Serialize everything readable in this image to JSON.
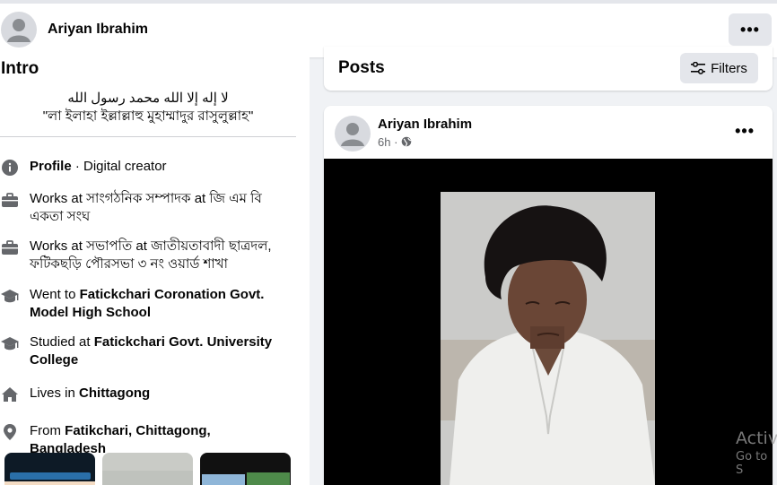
{
  "profile": {
    "name": "Ariyan Ibrahim",
    "more_label": "•••"
  },
  "intro": {
    "title": "Intro",
    "bio_line1": "لا إله إلا الله محمد رسول الله",
    "bio_line2": "\"লা ইলাহা ইল্লাল্লাহু মুহাম্মাদুর রাসুলুল্লাহ\"",
    "items": [
      {
        "icon": "info-icon",
        "bold": "Profile",
        "rest": " · Digital creator"
      },
      {
        "icon": "briefcase-icon",
        "text": "Works at সাংগঠনিক সম্পাদক at জি এম বি একতা সংঘ"
      },
      {
        "icon": "briefcase-icon",
        "text": "Works at সভাপতি at জাতীয়তাবাদী ছাত্রদল, ফটিকছড়ি পৌরসভা ৩ নং ওয়ার্ড শাখা"
      },
      {
        "icon": "graduation-cap-icon",
        "prefix": "Went to ",
        "bold": "Fatickchari Coronation Govt. Model High School"
      },
      {
        "icon": "graduation-cap-icon",
        "prefix": "Studied at ",
        "bold": "Fatickchari Govt. University College"
      },
      {
        "icon": "home-icon",
        "prefix": "Lives in ",
        "bold": "Chittagong"
      },
      {
        "icon": "location-pin-icon",
        "prefix": "From ",
        "bold": "Fatikchari, Chittagong, Bangladesh"
      }
    ]
  },
  "posts": {
    "title": "Posts",
    "filters_label": "Filters",
    "post": {
      "author": "Ariyan Ibrahim",
      "time": "6h ·",
      "privacy_icon": "globe-icon",
      "more_label": "•••"
    }
  },
  "watermark": {
    "line1": "Activ",
    "line2": "Go to S"
  }
}
